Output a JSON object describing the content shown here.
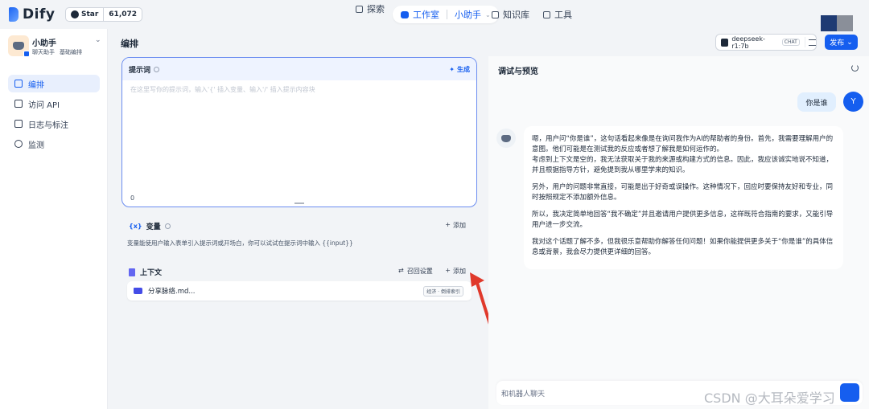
{
  "topbar": {
    "brand": "Dify",
    "star_label": "Star",
    "star_count": "61,072",
    "nav": {
      "explore": "探索",
      "studio": "工作室",
      "current_app": "小助手",
      "knowledge": "知识库",
      "tools": "工具"
    }
  },
  "sidebar": {
    "app_name": "小助手",
    "app_type": "聊天助手",
    "app_mode": "基础编排",
    "items": [
      {
        "label": "编排",
        "icon": "terminal-icon",
        "active": true
      },
      {
        "label": "访问 API",
        "icon": "api-icon",
        "active": false
      },
      {
        "label": "日志与标注",
        "icon": "log-icon",
        "active": false
      },
      {
        "label": "监测",
        "icon": "monitor-icon",
        "active": false
      }
    ]
  },
  "main": {
    "title": "编排",
    "model": {
      "name": "deepseek-r1:7b",
      "tag": "CHAT"
    },
    "publish": "发布",
    "prompt": {
      "title": "提示词",
      "generate": "生成",
      "placeholder": "在这里写你的提示词，输入'{' 插入变量、输入'/' 插入提示内容块",
      "count": "0"
    },
    "variables": {
      "title": "变量",
      "add": "添加",
      "description": "变量能使用户输入表单引入提示词或开场白，你可以试试在提示词中输入 {{input}}"
    },
    "context": {
      "title": "上下文",
      "recall_settings": "召回设置",
      "add": "添加",
      "file_name": "分享脉络.md...",
      "file_tag": "经济 · 倒排索引"
    }
  },
  "debug": {
    "title": "调试与预览",
    "user_message": "你是谁",
    "user_initial": "Y",
    "answer_paragraphs": [
      "嗯，用户问“你是谁”，这句话看起来像是在询问我作为AI的帮助者的身份。首先，我需要理解用户的意图。他们可能是在测试我的反应或者想了解我是如何运作的。\n考虑到上下文是空的，我无法获取关于我的来源或构建方式的信息。因此，我应该诚实地说不知道，并且根据指导方针，避免提到我从哪里学来的知识。",
      "另外，用户的问题非常直接，可能是出于好奇或误操作。这种情况下，回应时要保持友好和专业，同时按照规定不添加额外信息。",
      "所以，我决定简单地回答“我不确定”并且邀请用户提供更多信息，这样既符合指南的要求，又能引导用户进一步交流。",
      "我对这个话题了解不多，但我很乐意帮助你解答任何问题！如果你能提供更多关于“你是谁”的具体信息或背景，我会尽力提供更详细的回答。"
    ],
    "input_placeholder": "和机器人聊天"
  },
  "watermark": "CSDN @大耳朵爱学习",
  "colors": {
    "accent": "#155eef",
    "arrow": "#e0392b"
  }
}
